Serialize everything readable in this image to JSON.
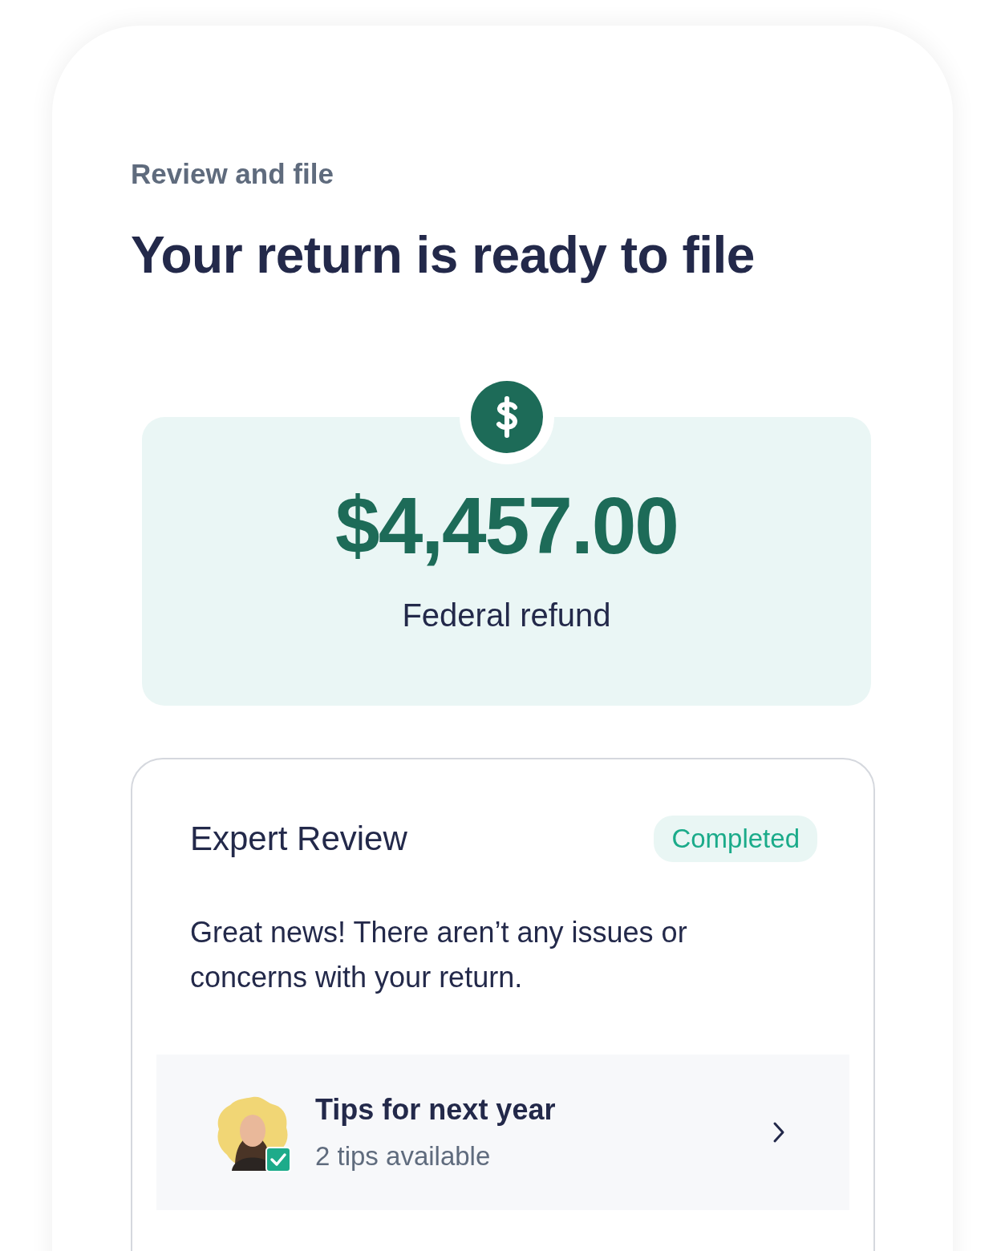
{
  "section_label": "Review and file",
  "title": "Your return is ready to file",
  "refund": {
    "amount": "$4,457.00",
    "label": "Federal refund"
  },
  "expert_review": {
    "title": "Expert Review",
    "status": "Completed",
    "message": "Great news! There aren’t any issues or concerns with your return.",
    "tips": {
      "title": "Tips for next year",
      "subtitle": "2 tips available"
    }
  }
}
